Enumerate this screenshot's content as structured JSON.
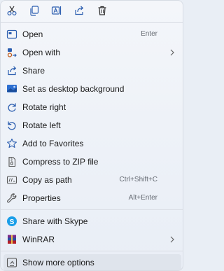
{
  "quick_actions": [
    {
      "icon": "cut-icon"
    },
    {
      "icon": "copy-icon"
    },
    {
      "icon": "rename-icon"
    },
    {
      "icon": "share-icon"
    },
    {
      "icon": "delete-icon"
    }
  ],
  "items": [
    {
      "label": "Open",
      "shortcut": "Enter",
      "icon": "open-icon"
    },
    {
      "label": "Open with",
      "icon": "open-with-icon",
      "submenu": true
    },
    {
      "label": "Share",
      "icon": "share-icon"
    },
    {
      "label": "Set as desktop background",
      "icon": "desktop-background-icon"
    },
    {
      "label": "Rotate right",
      "icon": "rotate-right-icon"
    },
    {
      "label": "Rotate left",
      "icon": "rotate-left-icon"
    },
    {
      "label": "Add to Favorites",
      "icon": "star-icon"
    },
    {
      "label": "Compress to ZIP file",
      "icon": "zip-icon"
    },
    {
      "label": "Copy as path",
      "shortcut": "Ctrl+Shift+C",
      "icon": "copy-path-icon"
    },
    {
      "label": "Properties",
      "shortcut": "Alt+Enter",
      "icon": "wrench-icon"
    }
  ],
  "app_items": [
    {
      "label": "Share with Skype",
      "icon": "skype-icon"
    },
    {
      "label": "WinRAR",
      "icon": "winrar-icon",
      "submenu": true
    }
  ],
  "more_options": {
    "label": "Show more options",
    "icon": "more-options-icon"
  },
  "colors": {
    "accent": "#2b6ac9",
    "skype": "#1a9ee8",
    "winrar_red": "#b3202a"
  }
}
